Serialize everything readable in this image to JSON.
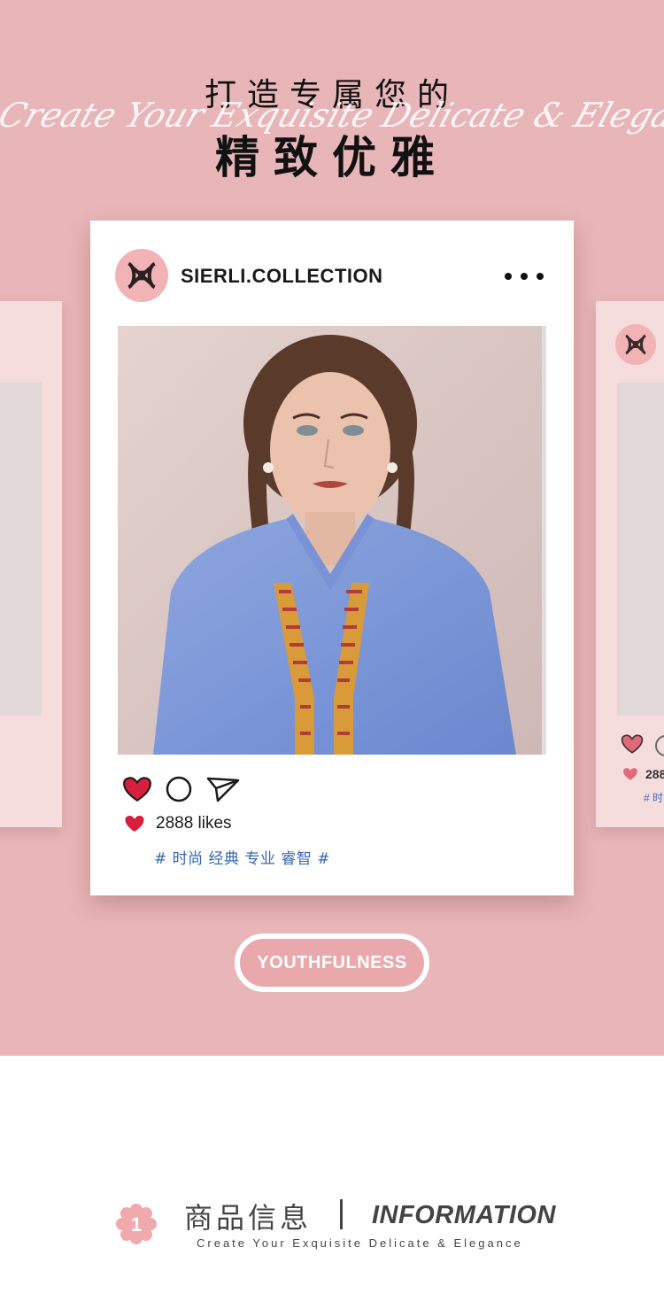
{
  "hero": {
    "title_line1": "打造专属您的",
    "script_text": "Create Your Exquisite Delicate & Elegance",
    "title_line2": "精致优雅"
  },
  "post": {
    "username": "SIERLI.COLLECTION",
    "likes_text": "2888 likes",
    "hashtags": "# 时尚 经典 专业 睿智 #",
    "icons": {
      "avatar": "brand-logo-icon",
      "more": "more-dots-icon",
      "like": "heart-icon",
      "comment": "comment-circle-icon",
      "share": "send-icon"
    }
  },
  "side_card": {
    "likes_text": "288",
    "hashtags": "# 时"
  },
  "pill_button": {
    "label": "YOUTHFULNESS"
  },
  "section": {
    "badge_number": "1",
    "title_cn": "商品信息",
    "title_en": "INFORMATION",
    "subtitle": "Create Your Exquisite Delicate & Elegance"
  },
  "colors": {
    "background_pink": "#e8b6b8",
    "logo_pink": "#f2b3b7",
    "heart_red": "#d61f3c",
    "hashtag_blue": "#3566b0",
    "heading_gray": "#444444"
  }
}
